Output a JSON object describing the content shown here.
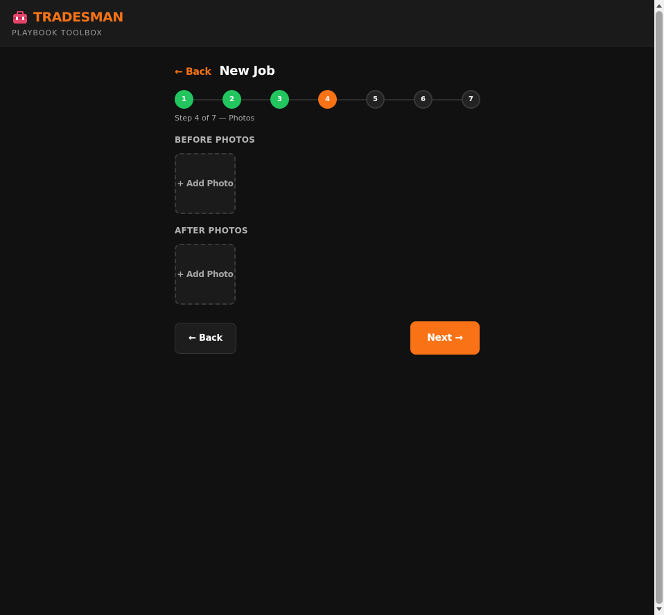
{
  "header": {
    "brand_name": "TRADESMAN",
    "brand_subtitle": "PLAYBOOK TOOLBOX",
    "brand_icon": "toolbox-icon",
    "brand_color": "#f97316"
  },
  "page": {
    "back_link": "← Back",
    "title": "New Job"
  },
  "stepper": {
    "steps": [
      {
        "label": "1",
        "status": "done"
      },
      {
        "label": "2",
        "status": "done"
      },
      {
        "label": "3",
        "status": "done"
      },
      {
        "label": "4",
        "status": "current"
      },
      {
        "label": "5",
        "status": "todo"
      },
      {
        "label": "6",
        "status": "todo"
      },
      {
        "label": "7",
        "status": "todo"
      }
    ],
    "caption": "Step 4 of 7 — Photos",
    "done_color": "#22c55e",
    "current_color": "#f97316"
  },
  "before": {
    "label": "BEFORE PHOTOS",
    "add_label": "+ Add Photo"
  },
  "after": {
    "label": "AFTER PHOTOS",
    "add_label": "+ Add Photo"
  },
  "footer": {
    "back_label": "← Back",
    "next_label": "Next →"
  }
}
